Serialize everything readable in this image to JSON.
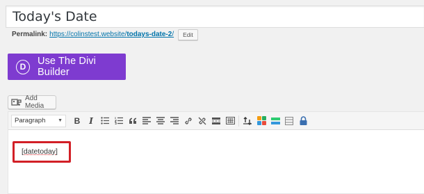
{
  "post": {
    "title": "Today's Date",
    "permalink_label": "Permalink:",
    "permalink_base": "https://colinstest.website/",
    "permalink_slug": "todays-date-2",
    "permalink_tail": "/",
    "edit_label": "Edit"
  },
  "divi": {
    "logo_letter": "D",
    "label": "Use The Divi Builder",
    "color": "#7e3bd0"
  },
  "media": {
    "add_media_label": "Add Media"
  },
  "toolbar": {
    "format_value": "Paragraph",
    "buttons": [
      "bold",
      "italic",
      "bulleted-list",
      "numbered-list",
      "blockquote",
      "align-left",
      "align-center",
      "align-right",
      "insert-link",
      "remove-link",
      "read-more",
      "toolbar-toggle",
      "shortcode-sort",
      "color-blocks",
      "divider",
      "table",
      "lock"
    ]
  },
  "editor": {
    "content": "[datetoday]",
    "highlight_color": "#d21f26"
  }
}
